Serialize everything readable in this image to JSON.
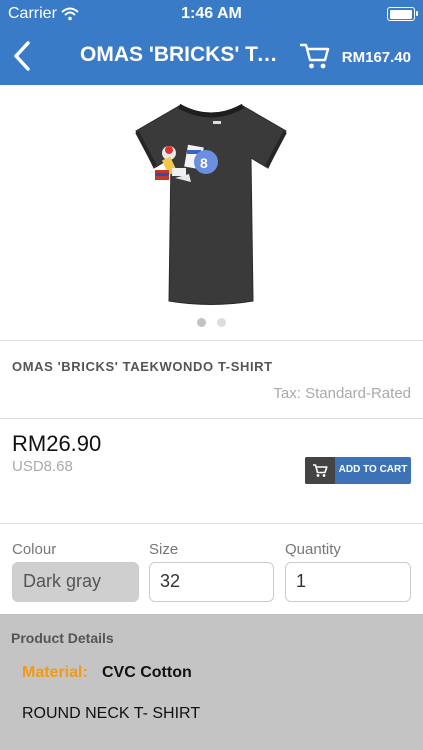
{
  "status_bar": {
    "carrier": "Carrier",
    "time": "1:46 AM",
    "icons": [
      "wifi-icon",
      "battery-icon"
    ]
  },
  "nav": {
    "back_icon": "chevron-left-icon",
    "title": "OMAS 'BRICKS' TAEKWONDO T-SHIRT",
    "cart_icon": "cart-icon",
    "cart_total": "RM167.40",
    "bar_color": "#3a7bc8"
  },
  "gallery": {
    "image": "tshirt-image",
    "page_count": 2,
    "current_page": 1
  },
  "product": {
    "name": "OMAS 'BRICKS' TAEKWONDO T-SHIRT",
    "tax": "Tax: Standard-Rated",
    "price": "RM26.90",
    "price_usd": "USD8.68",
    "add_to_cart_label": "ADD TO CART",
    "accent_color": "#3d72b7"
  },
  "options": {
    "colour": {
      "label": "Colour",
      "value": "Dark gray"
    },
    "size": {
      "label": "Size",
      "value": "32"
    },
    "quantity": {
      "label": "Quantity",
      "value": "1"
    }
  },
  "details": {
    "title": "Product Details",
    "material_key": "Material:",
    "material_value": "CVC Cotton",
    "description": "ROUND NECK T- SHIRT",
    "highlight_color": "#f29a16"
  }
}
